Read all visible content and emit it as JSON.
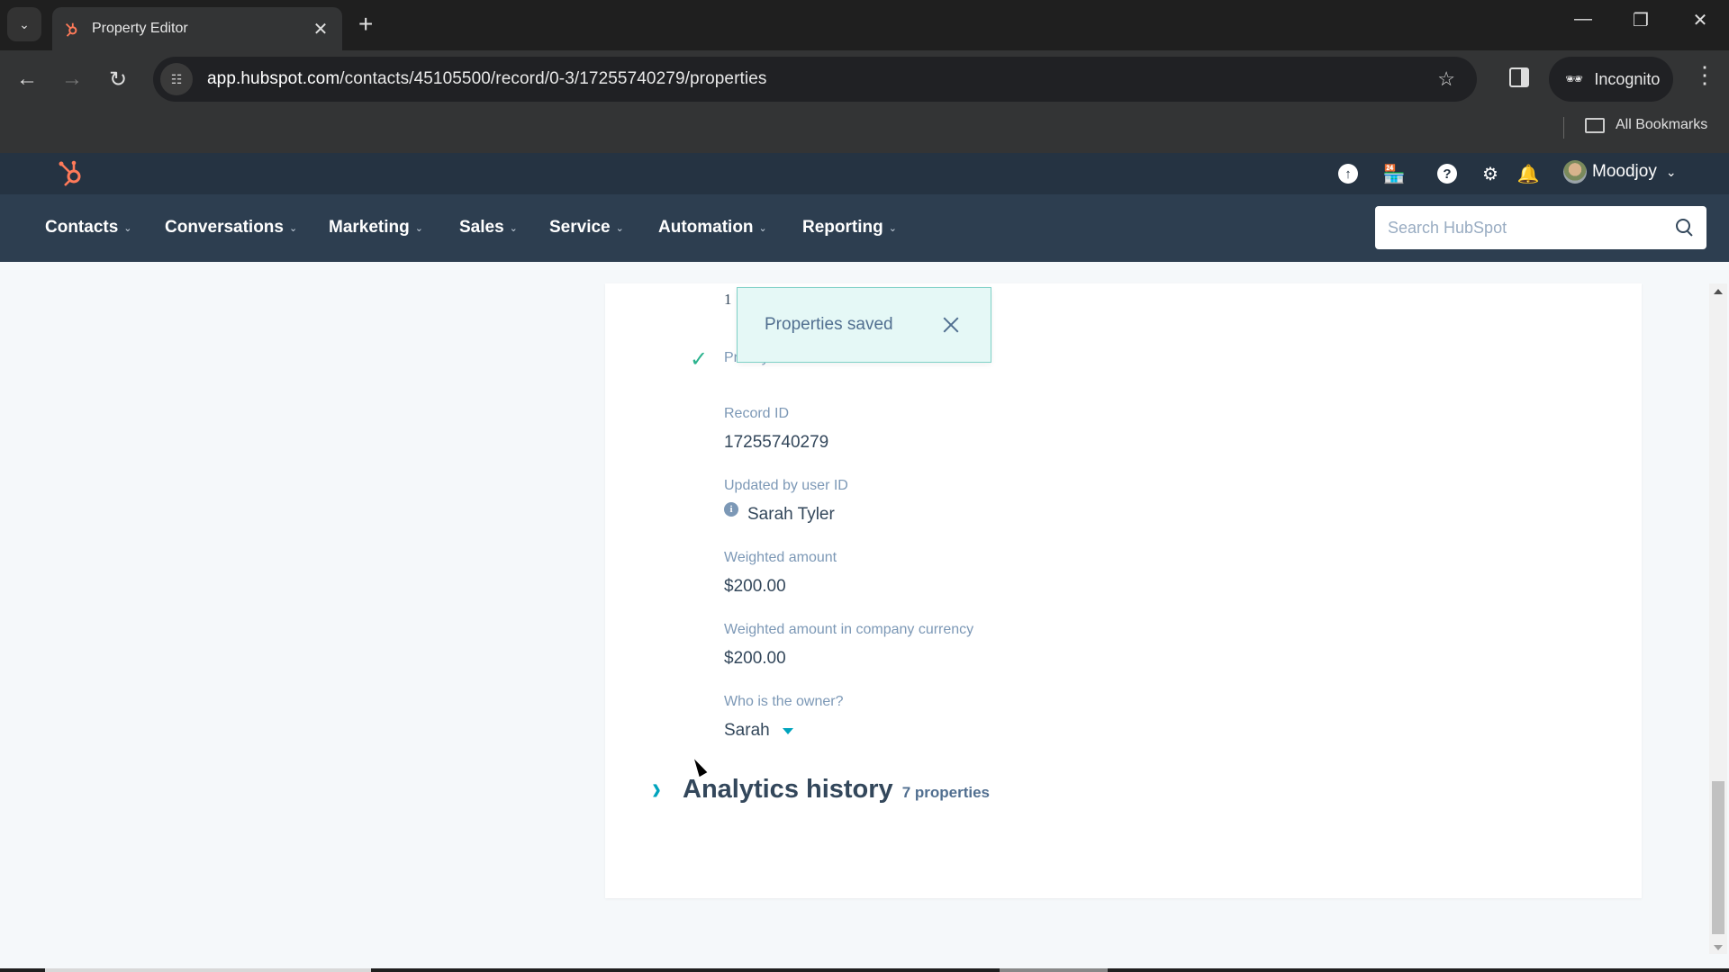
{
  "browser": {
    "tab_title": "Property Editor",
    "new_tab_symbol": "+",
    "url_host": "app.hubspot.com",
    "url_path": "/contacts/45105500/record/0-3/17255740279/properties",
    "profile_label": "Incognito",
    "bookmarks_label": "All Bookmarks"
  },
  "hubspot": {
    "brand_color": "#ff7a59",
    "account_name": "Moodjoy",
    "nav": [
      {
        "label": "Contacts"
      },
      {
        "label": "Conversations"
      },
      {
        "label": "Marketing"
      },
      {
        "label": "Sales"
      },
      {
        "label": "Service"
      },
      {
        "label": "Automation"
      },
      {
        "label": "Reporting"
      }
    ],
    "search_placeholder": "Search HubSpot"
  },
  "properties": {
    "partial_value": "1",
    "partial_label": "Priority",
    "fields": [
      {
        "label": "Record ID",
        "value": "17255740279"
      },
      {
        "label": "Updated by user ID",
        "value": "Sarah Tyler"
      },
      {
        "label": "Weighted amount",
        "value": "$200.00"
      },
      {
        "label": "Weighted amount in company currency",
        "value": "$200.00"
      },
      {
        "label": "Who is the owner?",
        "value": "Sarah"
      }
    ],
    "section": {
      "title": "Analytics history",
      "count": "7 properties"
    }
  },
  "toast": {
    "message": "Properties saved"
  }
}
